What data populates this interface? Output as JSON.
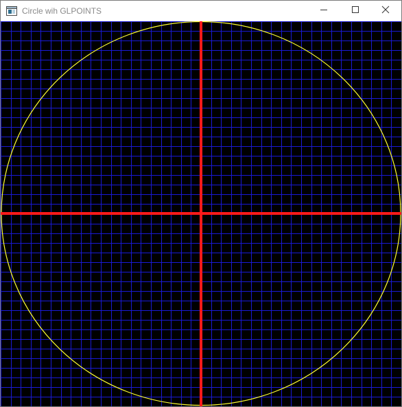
{
  "window": {
    "title": "Circle wih GLPOINTS",
    "app_icon": "opengl-window-icon",
    "controls": {
      "minimize_icon": "minimize-icon",
      "maximize_icon": "maximize-icon",
      "close_icon": "close-icon"
    }
  },
  "scene": {
    "background_color": "#000000",
    "grid_color": "#1a1ad6",
    "grid_divisions": 40,
    "axis_color": "#ff1a1a",
    "circle_color": "#ffff33",
    "circle_radius_fraction": 1.0
  }
}
